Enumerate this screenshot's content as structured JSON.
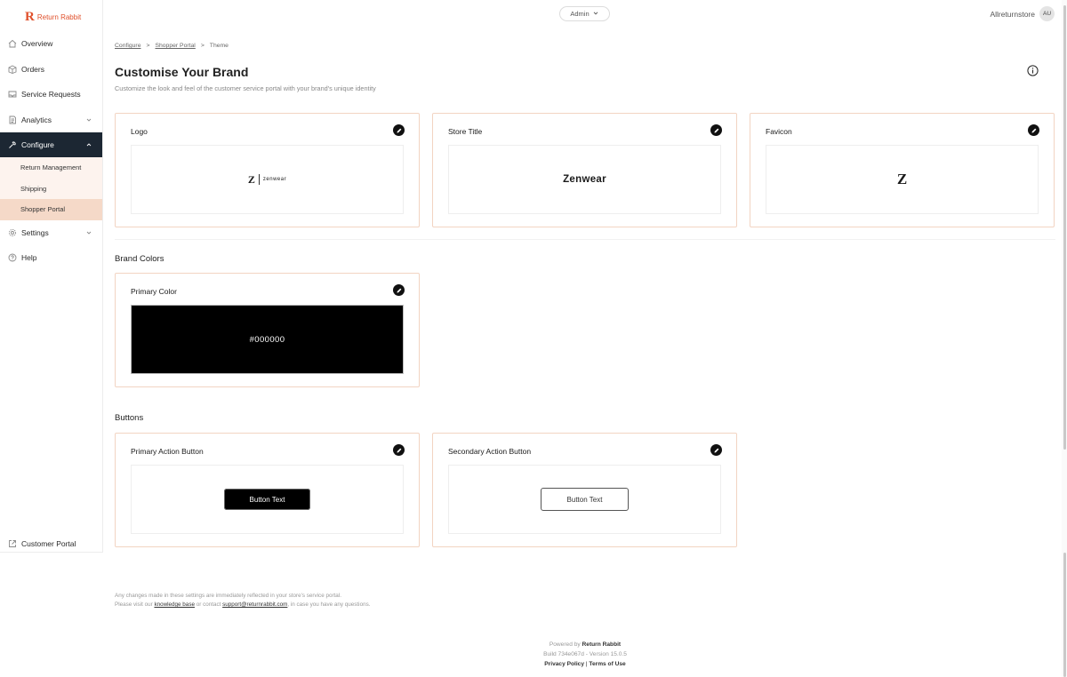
{
  "app": {
    "logo_mark": "R",
    "logo_name": "Return Rabbit",
    "brand_color": "#e0502b"
  },
  "topbar": {
    "role_label": "Admin",
    "store_name": "Allreturnstore",
    "avatar_initials": "AU"
  },
  "sidebar": {
    "items": [
      {
        "label": "Overview",
        "icon": "home-icon"
      },
      {
        "label": "Orders",
        "icon": "box-icon"
      },
      {
        "label": "Service Requests",
        "icon": "inbox-icon"
      },
      {
        "label": "Analytics",
        "icon": "report-icon"
      },
      {
        "label": "Configure",
        "icon": "wrench-icon"
      },
      {
        "label": "Settings",
        "icon": "gear-icon"
      },
      {
        "label": "Help",
        "icon": "help-icon"
      }
    ],
    "configure_sub": [
      "Return Management",
      "Shipping",
      "Shopper Portal"
    ],
    "customer_portal": "Customer Portal",
    "active_bg": "#1c2733"
  },
  "breadcrumb": {
    "c1": "Configure",
    "sep": ">",
    "c2": "Shopper Portal",
    "c3": "Theme"
  },
  "page": {
    "title": "Customise Your Brand",
    "subtitle": "Customize the look and feel of the customer service portal with your brand's unique identity"
  },
  "cards": {
    "logo": {
      "title": "Logo",
      "mark": "Z",
      "word": "zenwear"
    },
    "store_title": {
      "title": "Store Title",
      "value": "Zenwear"
    },
    "favicon": {
      "title": "Favicon",
      "mark": "Z"
    }
  },
  "brand_colors": {
    "section": "Brand Colors",
    "primary_title": "Primary Color",
    "primary_value": "#000000"
  },
  "buttons": {
    "section": "Buttons",
    "primary_title": "Primary Action Button",
    "primary_text": "Button Text",
    "secondary_title": "Secondary Action Button",
    "secondary_text": "Button Text"
  },
  "footer": {
    "note1": "Any changes made in these settings are immediately reflected in your store's service portal.",
    "note2_a": "Please visit our",
    "note2_link1": "knowledge base",
    "note2_b": "or contact",
    "note2_link2": "support@returnrabbit.com",
    "note2_c": ", in case you have any questions.",
    "powered_prefix": "Powered by",
    "powered_brand": "Return Rabbit",
    "build": "Build 734e067d - Version 15.0.5",
    "privacy": "Privacy Policy",
    "pipe": "|",
    "terms": "Terms of Use"
  }
}
